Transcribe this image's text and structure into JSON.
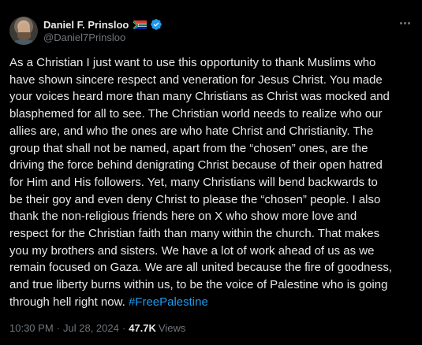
{
  "author": {
    "display_name": "Daniel F. Prinsloo",
    "handle": "@Daniel7Prinsloo",
    "flag_icon": "south-africa-flag-icon",
    "verified_icon": "verified-badge-icon",
    "verified_color": "#1d9bf0"
  },
  "tweet": {
    "lines": [
      "As a Christian I just want to use this opportunity to thank Muslims who",
      "have shown sincere respect and veneration for Jesus Christ. You made",
      "your voices heard more than many Christians as Christ was mocked and",
      "blasphemed for all to see. The Christian world needs to realize who our",
      "allies are, and who the ones are who hate Christ and Christianity. The",
      "group that shall not be named, apart from the “chosen” ones, are the",
      "driving the force behind denigrating Christ because of their open hatred",
      "for Him and His followers. Yet, many Christians will bend backwards to",
      "be their goy and even deny Christ to please the “chosen” people. I also",
      "thank the non-religious friends here on X who show more love and",
      "respect for the Christian faith than many within the church. That makes",
      "you my brothers and sisters. We have a lot of work ahead of us as we",
      "remain focused on Gaza. We are all united because the fire of goodness,",
      "and true liberty burns within us, to be the voice of Palestine who is going"
    ],
    "last_line_text": "through hell right now. ",
    "hashtag": "#FreePalestine"
  },
  "meta": {
    "time": "10:30 PM",
    "separator": "·",
    "date": "Jul 28, 2024",
    "views_count": "47.7K",
    "views_label": "Views"
  },
  "colors": {
    "background": "#000000",
    "text": "#e7e9ea",
    "secondary": "#71767b",
    "link": "#1d9bf0"
  },
  "icons": {
    "more": "more-options-icon"
  }
}
